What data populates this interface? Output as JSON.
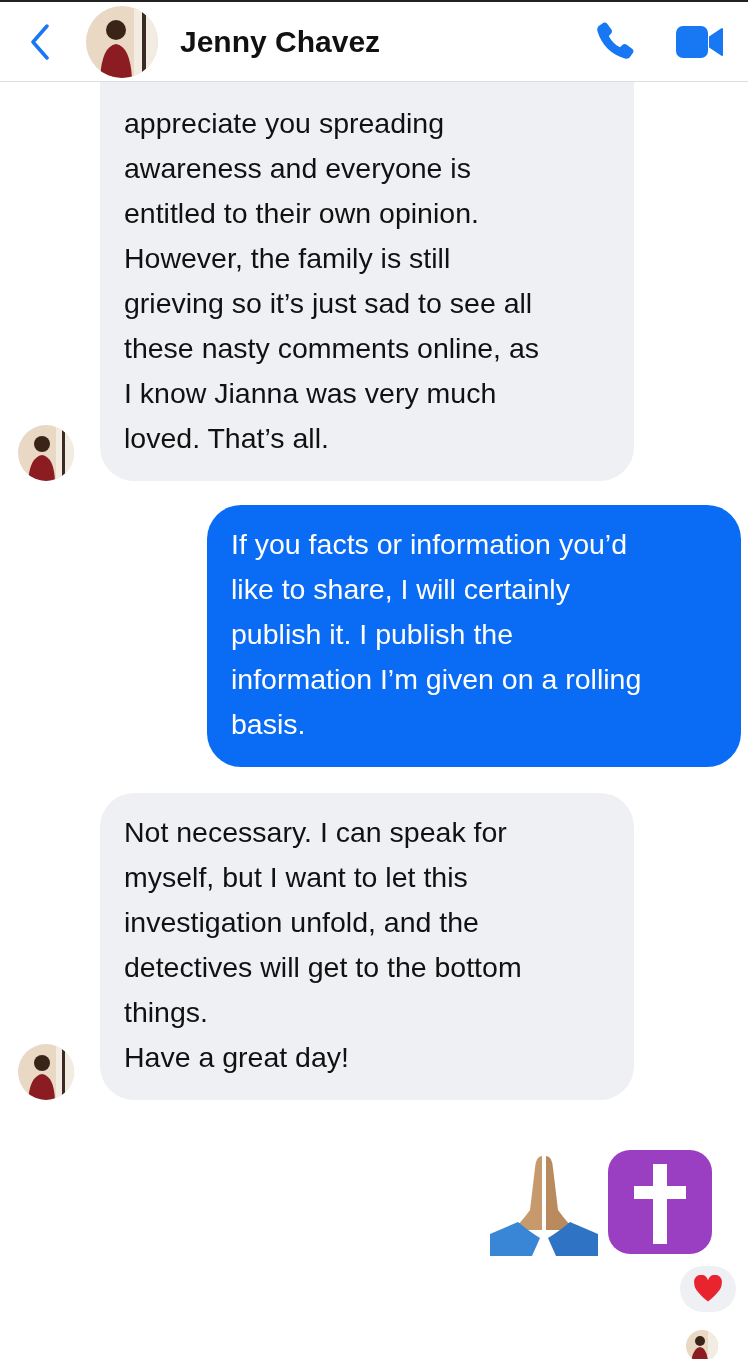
{
  "header": {
    "contact_name": "Jenny Chavez"
  },
  "messages": [
    {
      "kind": "incoming",
      "clipped_top": true,
      "avatar": true,
      "lines": [
        "appreciate you spreading",
        "awareness and everyone is",
        "entitled to their own opinion.",
        "However, the family is still",
        "grieving so it’s just sad to see all",
        "these nasty comments online, as",
        "I know Jianna was very much",
        "loved. That’s all."
      ]
    },
    {
      "kind": "outgoing",
      "clipped_top": false,
      "lines": [
        "If you facts or information you’d",
        "like to share, I will certainly",
        "publish it. I publish the",
        "information I’m given on a rolling",
        "basis."
      ]
    },
    {
      "kind": "incoming",
      "clipped_top": false,
      "avatar": true,
      "lines": [
        "Not necessary. I can speak for",
        "myself, but I want to let this",
        "investigation unfold, and the",
        "detectives will get to the bottom",
        "things.",
        "Have a great day!"
      ]
    },
    {
      "kind": "emoji"
    }
  ],
  "reaction": {
    "kind": "heart"
  },
  "read_receipt": true
}
